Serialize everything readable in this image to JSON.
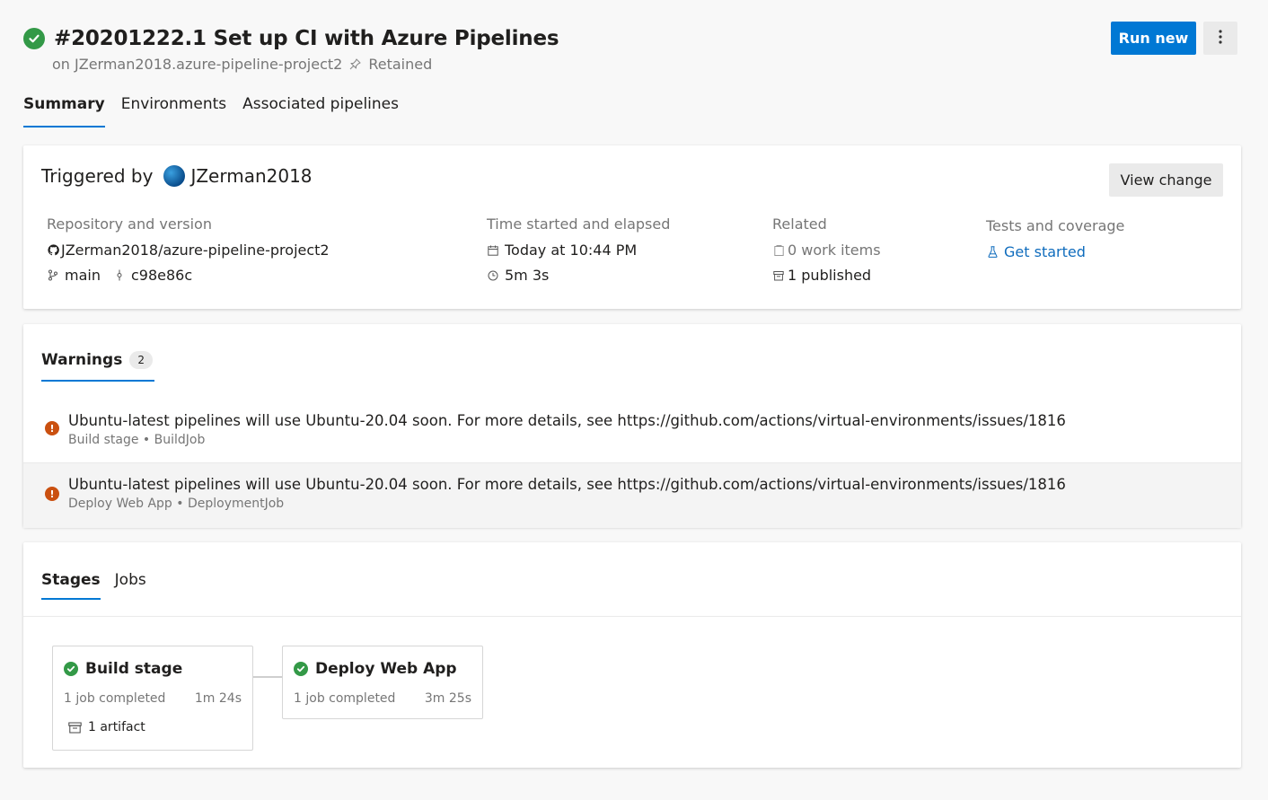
{
  "header": {
    "title": "#20201222.1 Set up CI with Azure Pipelines",
    "subtitle_repo": "on JZerman2018.azure-pipeline-project2",
    "retained": "Retained",
    "run_new": "Run new"
  },
  "tabs": [
    "Summary",
    "Environments",
    "Associated pipelines"
  ],
  "summary": {
    "triggered_by_label": "Triggered by",
    "triggered_by_user": "JZerman2018",
    "view_change": "View change",
    "repo_head": "Repository and version",
    "repo_name": "JZerman2018/azure-pipeline-project2",
    "branch": "main",
    "commit": "c98e86c",
    "time_head": "Time started and elapsed",
    "started": "Today at 10:44 PM",
    "elapsed": "5m 3s",
    "related_head": "Related",
    "work_items": "0 work items",
    "published": "1 published",
    "tests_head": "Tests and coverage",
    "get_started": "Get started"
  },
  "warnings": {
    "tab_label": "Warnings",
    "count": "2",
    "items": [
      {
        "message": "Ubuntu-latest pipelines will use Ubuntu-20.04 soon. For more details, see https://github.com/actions/virtual-environments/issues/1816",
        "source": "Build stage • BuildJob"
      },
      {
        "message": "Ubuntu-latest pipelines will use Ubuntu-20.04 soon. For more details, see https://github.com/actions/virtual-environments/issues/1816",
        "source": "Deploy Web App • DeploymentJob"
      }
    ]
  },
  "stages": {
    "tabs": [
      "Stages",
      "Jobs"
    ],
    "items": [
      {
        "name": "Build stage",
        "status": "1 job completed",
        "duration": "1m 24s",
        "artifact": "1 artifact"
      },
      {
        "name": "Deploy Web App",
        "status": "1 job completed",
        "duration": "3m 25s"
      }
    ]
  },
  "colors": {
    "accent": "#0078d4",
    "success": "#339947",
    "warning": "#ca5010"
  }
}
